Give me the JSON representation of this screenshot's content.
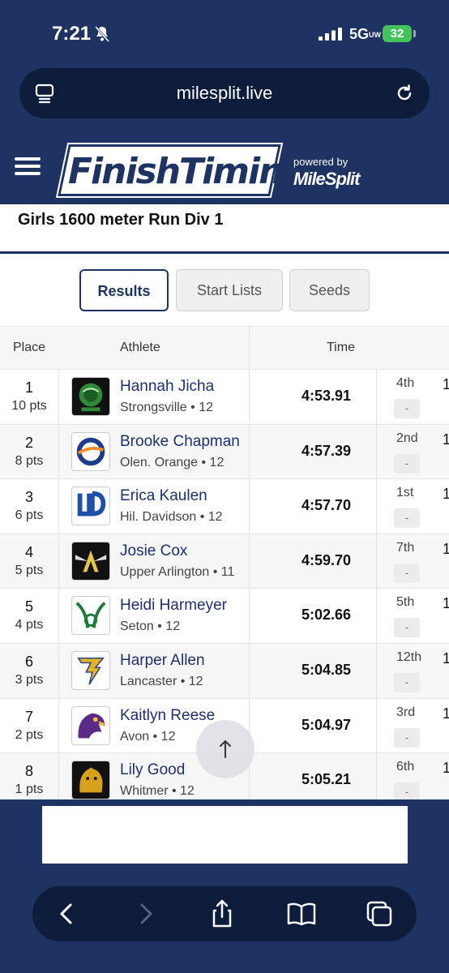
{
  "status_bar": {
    "time": "7:21",
    "network": "5G",
    "network_sub": "UW",
    "battery": "32"
  },
  "browser": {
    "url": "milesplit.live"
  },
  "header": {
    "logo_text": "FinishTiming",
    "powered_by": "powered by",
    "partner": "MileSplit"
  },
  "event": {
    "title": "Girls 1600 meter Run Div 1"
  },
  "tabs": [
    {
      "label": "Results",
      "active": true
    },
    {
      "label": "Start Lists",
      "active": false
    },
    {
      "label": "Seeds",
      "active": false
    }
  ],
  "table": {
    "headers": {
      "place": "Place",
      "athlete": "Athlete",
      "time": "Time"
    },
    "rows": [
      {
        "place": "1",
        "pts": "10 pts",
        "name": "Hannah Jicha",
        "school": "Strongsville • 12",
        "time": "4:53.91",
        "heat_place": "4th",
        "heat_box": "-",
        "extra": "1"
      },
      {
        "place": "2",
        "pts": "8 pts",
        "name": "Brooke Chapman",
        "school": "Olen. Orange • 12",
        "time": "4:57.39",
        "heat_place": "2nd",
        "heat_box": "-",
        "extra": "1"
      },
      {
        "place": "3",
        "pts": "6 pts",
        "name": "Erica Kaulen",
        "school": "Hil. Davidson • 12",
        "time": "4:57.70",
        "heat_place": "1st",
        "heat_box": "-",
        "extra": "1"
      },
      {
        "place": "4",
        "pts": "5 pts",
        "name": "Josie Cox",
        "school": "Upper Arlington • 11",
        "time": "4:59.70",
        "heat_place": "7th",
        "heat_box": "-",
        "extra": "1"
      },
      {
        "place": "5",
        "pts": "4 pts",
        "name": "Heidi Harmeyer",
        "school": "Seton • 12",
        "time": "5:02.66",
        "heat_place": "5th",
        "heat_box": "-",
        "extra": "1"
      },
      {
        "place": "6",
        "pts": "3 pts",
        "name": "Harper Allen",
        "school": "Lancaster • 12",
        "time": "5:04.85",
        "heat_place": "12th",
        "heat_box": "-",
        "extra": "1"
      },
      {
        "place": "7",
        "pts": "2 pts",
        "name": "Kaitlyn Reese",
        "school": "Avon • 12",
        "time": "5:04.97",
        "heat_place": "3rd",
        "heat_box": "-",
        "extra": "1"
      },
      {
        "place": "8",
        "pts": "1 pts",
        "name": "Lily Good",
        "school": "Whitmer • 12",
        "time": "5:05.21",
        "heat_place": "6th",
        "heat_box": "-",
        "extra": "1"
      }
    ]
  },
  "colors": {
    "navy": "#1e3362",
    "link": "#1e2f6e",
    "battery_green": "#42c45a"
  },
  "icons": {
    "scroll_top": "arrow-up-icon",
    "toolbar": [
      "back-icon",
      "forward-icon",
      "share-icon",
      "bookmarks-icon",
      "tabs-icon"
    ]
  }
}
